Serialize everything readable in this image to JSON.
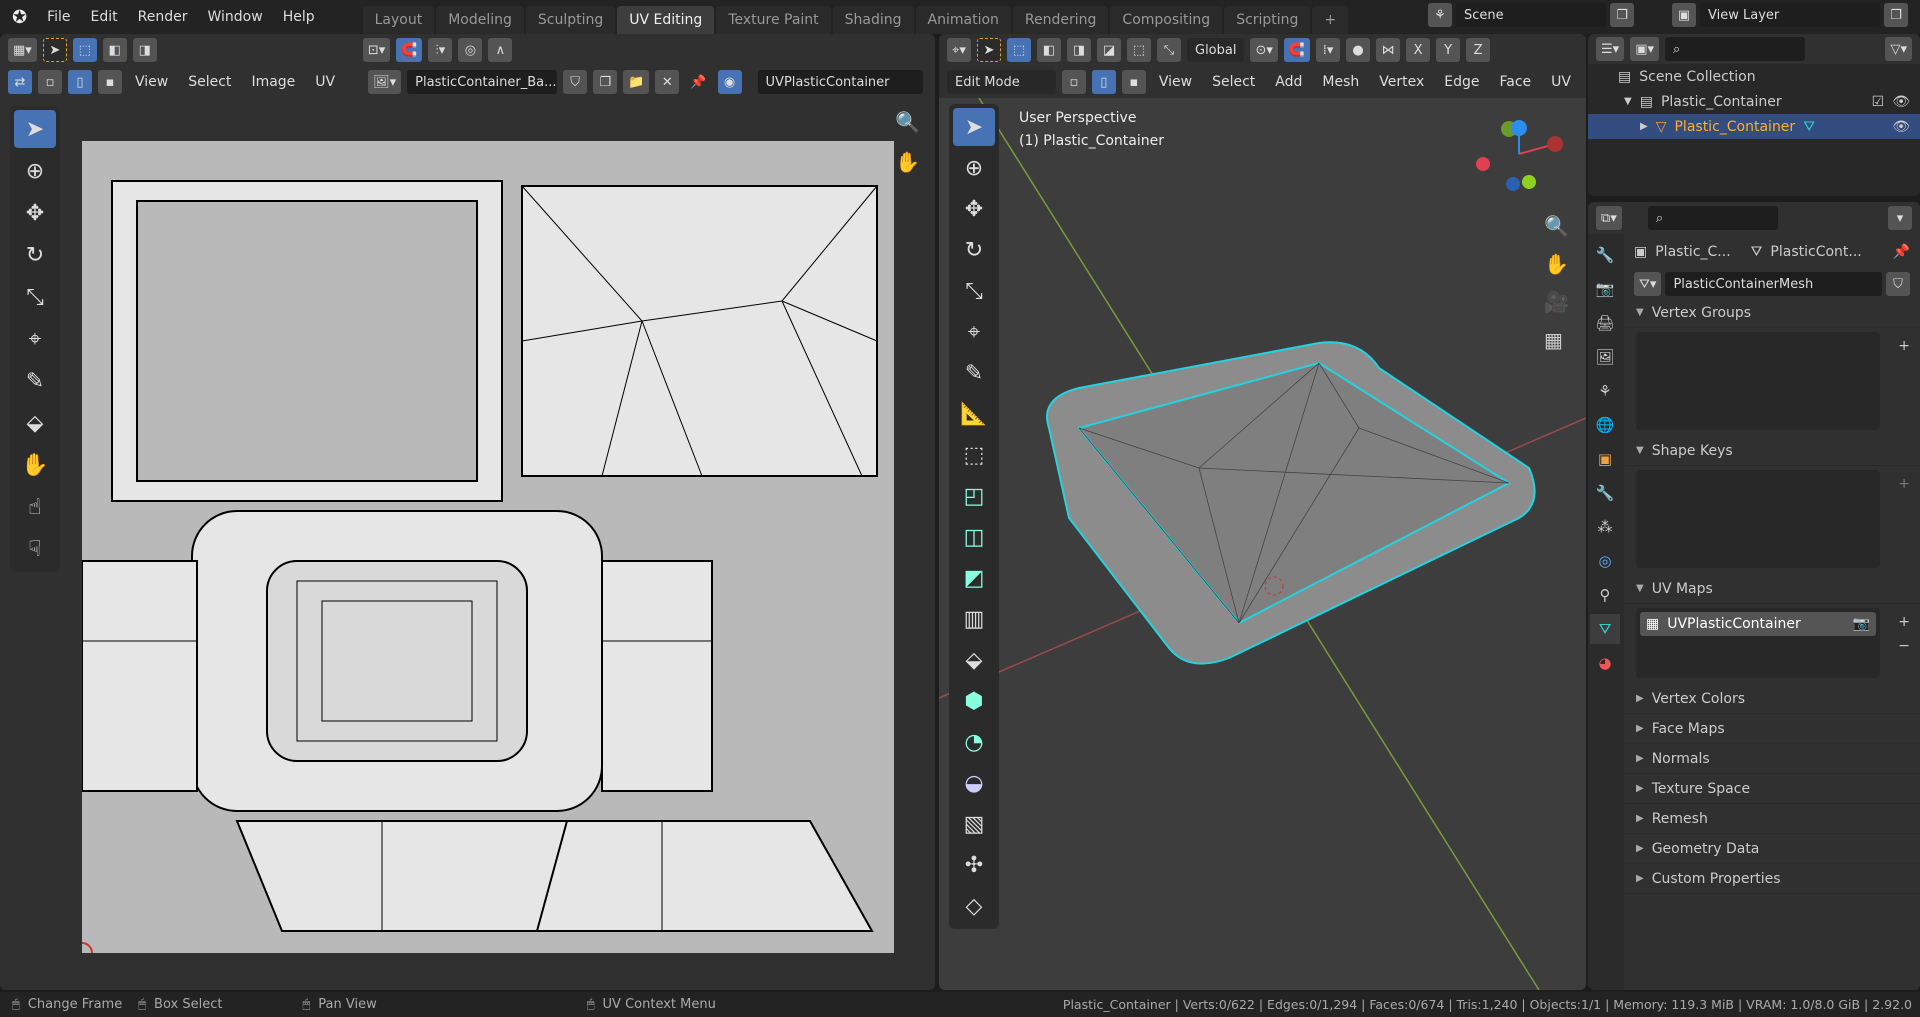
{
  "topbar": {
    "menus": [
      "File",
      "Edit",
      "Render",
      "Window",
      "Help"
    ],
    "workspaces": [
      "Layout",
      "Modeling",
      "Sculpting",
      "UV Editing",
      "Texture Paint",
      "Shading",
      "Animation",
      "Rendering",
      "Compositing",
      "Scripting"
    ],
    "active_workspace": "UV Editing",
    "add_tab": "+",
    "scene": "Scene",
    "view_layer": "View Layer"
  },
  "uv_editor": {
    "menus": [
      "View",
      "Select",
      "Image",
      "UV"
    ],
    "image_name": "PlasticContainer_Ba...",
    "uv_map": "UVPlasticContainer"
  },
  "viewport": {
    "mode": "Edit Mode",
    "orientation": "Global",
    "menus": [
      "View",
      "Select",
      "Add",
      "Mesh",
      "Vertex",
      "Edge",
      "Face",
      "UV"
    ],
    "overlay_title": "User Perspective",
    "overlay_object": "(1) Plastic_Container",
    "axes": [
      "X",
      "Y",
      "Z"
    ]
  },
  "outliner": {
    "scene_collection": "Scene Collection",
    "collection": "Plastic_Container",
    "object": "Plastic_Container"
  },
  "properties": {
    "object_crumb": "Plastic_C...",
    "mesh_crumb": "PlasticCont...",
    "mesh_name": "PlasticContainerMesh",
    "sections": {
      "vertex_groups": "Vertex Groups",
      "shape_keys": "Shape Keys",
      "uv_maps": "UV Maps"
    },
    "uv_map_item": "UVPlasticContainer",
    "collapsed": [
      "Vertex Colors",
      "Face Maps",
      "Normals",
      "Texture Space",
      "Remesh",
      "Geometry Data",
      "Custom Properties"
    ]
  },
  "statusbar": {
    "change_frame": "Change Frame",
    "box_select": "Box Select",
    "pan_view": "Pan View",
    "context_menu": "UV Context Menu",
    "stats": "Plastic_Container | Verts:0/622 | Edges:0/1,294 | Faces:0/674 | Tris:1,240 | Objects:1/1 | Memory: 119.3 MiB | VRAM: 1.0/8.0 GiB | 2.92.0"
  },
  "colors": {
    "accent": "#4772b3",
    "selected_text": "#ffaf29",
    "edge_highlight": "#23d3e0"
  }
}
